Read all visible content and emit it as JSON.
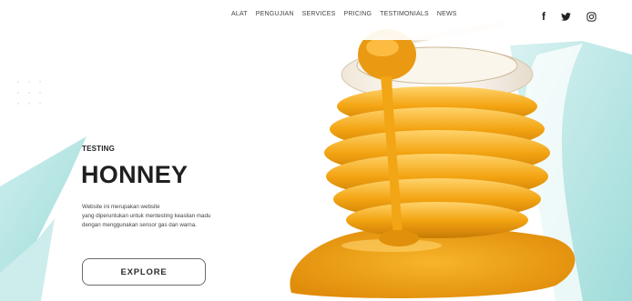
{
  "nav": {
    "items": [
      "ALAT",
      "PENGUJIAN",
      "SERVICES",
      "PRICING",
      "TESTIMONIALS",
      "NEWS"
    ],
    "social": [
      {
        "icon": "facebook-icon",
        "glyph": "f"
      },
      {
        "icon": "twitter-icon"
      },
      {
        "icon": "instagram-icon"
      }
    ]
  },
  "hero": {
    "kicker": "TESTING",
    "title": "HONNEY",
    "desc_lines": [
      "Website ini merupakan website",
      "yang diperuntukan untuk mentesting keaslian madu",
      "dengan menggunakan sensor gas dan warna."
    ],
    "button_label": "EXPLORE"
  },
  "theme": {
    "accent": "#a9e1e0",
    "honey": "#f2a515",
    "text": "#1f1f1f"
  }
}
